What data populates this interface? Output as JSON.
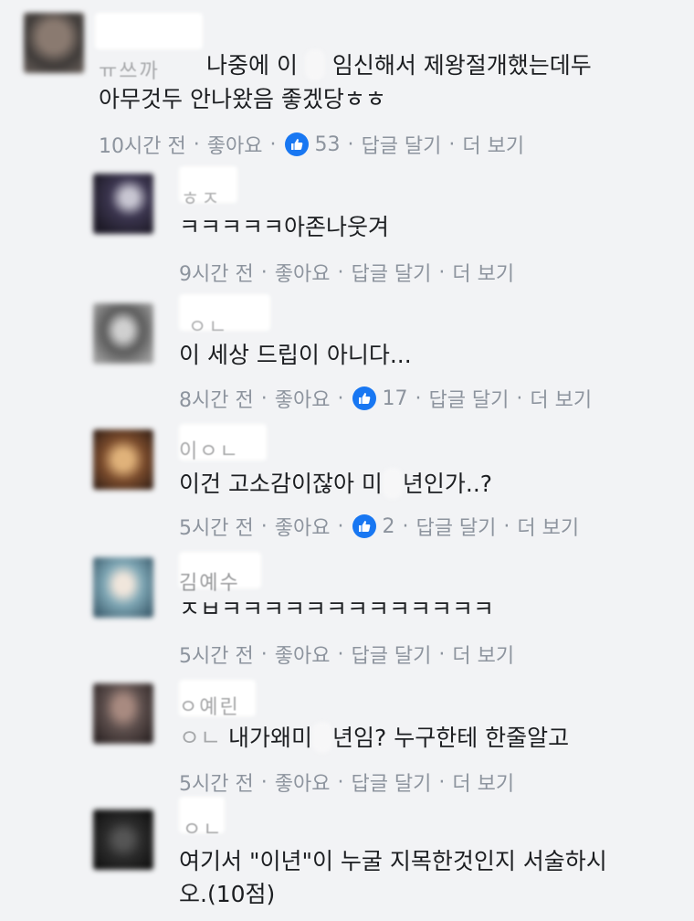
{
  "comments": [
    {
      "name_fragment": "ㅠ쓰까",
      "text_line1_a": "나중에 이",
      "text_line1_b": "임신해서 제왕절개했는데두",
      "text_line2": "아무것두 안나왔음 좋겠당ㅎㅎ",
      "time": "10시간 전",
      "like_label": "좋아요",
      "like_count": "53",
      "reply_label": "답글 달기",
      "more_label": "더 보기",
      "avatar_color": "#6b625d"
    },
    {
      "name_fragment": "ㅎㅈ",
      "text": "ㅋㅋㅋㅋㅋ아존나웃겨",
      "time": "9시간 전",
      "like_label": "좋아요",
      "reply_label": "답글 달기",
      "more_label": "더 보기",
      "avatar_color": "#2e2a3b"
    },
    {
      "name_fragment": "ㅇㄴ",
      "text": "이 세상 드립이 아니다...",
      "time": "8시간 전",
      "like_label": "좋아요",
      "like_count": "17",
      "reply_label": "답글 달기",
      "more_label": "더 보기",
      "avatar_color": "#8b8b8b"
    },
    {
      "name_fragment": "이ㅇㄴ",
      "text_a": "이건 고소감이잖아 미",
      "text_b": "년인가..?",
      "time": "5시간 전",
      "like_label": "좋아요",
      "like_count": "2",
      "reply_label": "답글 달기",
      "more_label": "더 보기",
      "avatar_color": "#7a4b2c"
    },
    {
      "name_fragment": "김예수",
      "text": "ㅈㅂㅋㅋㅋㅋㅋㅋㅋㅋㅋㅋㅋㅋㅋ",
      "time": "5시간 전",
      "like_label": "좋아요",
      "reply_label": "답글 달기",
      "more_label": "더 보기",
      "avatar_color": "#7fa7b5"
    },
    {
      "name_fragment": "ㅇ예린",
      "text_prefix": "ㅇㄴ",
      "text_a": "내가왜미",
      "text_b": "년임? 누구한테 한줄알고",
      "time": "5시간 전",
      "like_label": "좋아요",
      "reply_label": "답글 달기",
      "more_label": "더 보기",
      "avatar_color": "#5c4e4c"
    },
    {
      "name_fragment": "ㅇㄴ",
      "text_line1": "여기서 \"이년\"이 누굴 지목한것인지 서술하시",
      "text_line2": "오.(10점)",
      "avatar_color": "#2a2a2a"
    }
  ],
  "colors": {
    "background": "#f2f3f5",
    "meta_text": "#8d949e",
    "like_blue": "#1877f2"
  },
  "icons": {
    "like": "thumbs-up-icon"
  }
}
